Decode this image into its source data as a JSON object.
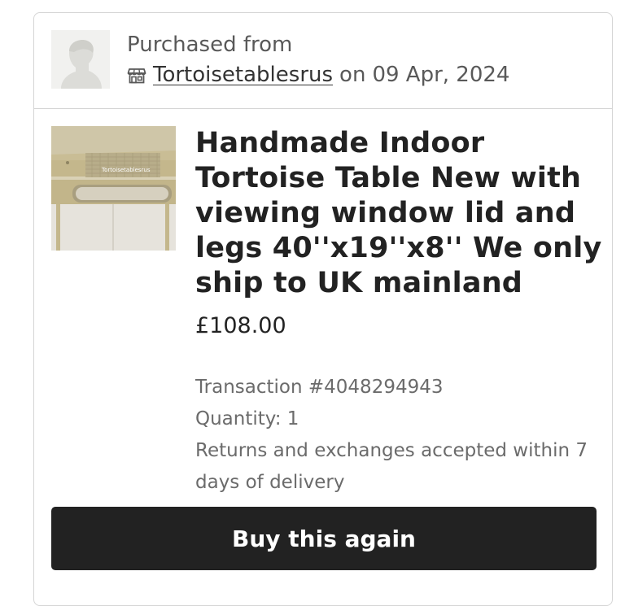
{
  "shop": {
    "purchased_label": "Purchased from",
    "name": "Tortoisetablesrus",
    "on_text": "on",
    "date": "09 Apr, 2024"
  },
  "item": {
    "title": "Handmade Indoor Tortoise Table New with viewing window lid and legs 40''x19''x8'' We only ship to UK mainland",
    "image_watermark": "Tortoisetablesrus",
    "price": "£108.00",
    "transaction": "Transaction #4048294943",
    "quantity": "Quantity: 1",
    "returns": "Returns and exchanges accepted within 7 days of delivery"
  },
  "actions": {
    "buy_again_label": "Buy this again"
  },
  "colors": {
    "button_bg": "#222222",
    "border": "#d5d5d5",
    "muted_text": "#6b6b6b"
  },
  "icons": {
    "shop": "shop-icon",
    "avatar": "avatar-placeholder"
  }
}
